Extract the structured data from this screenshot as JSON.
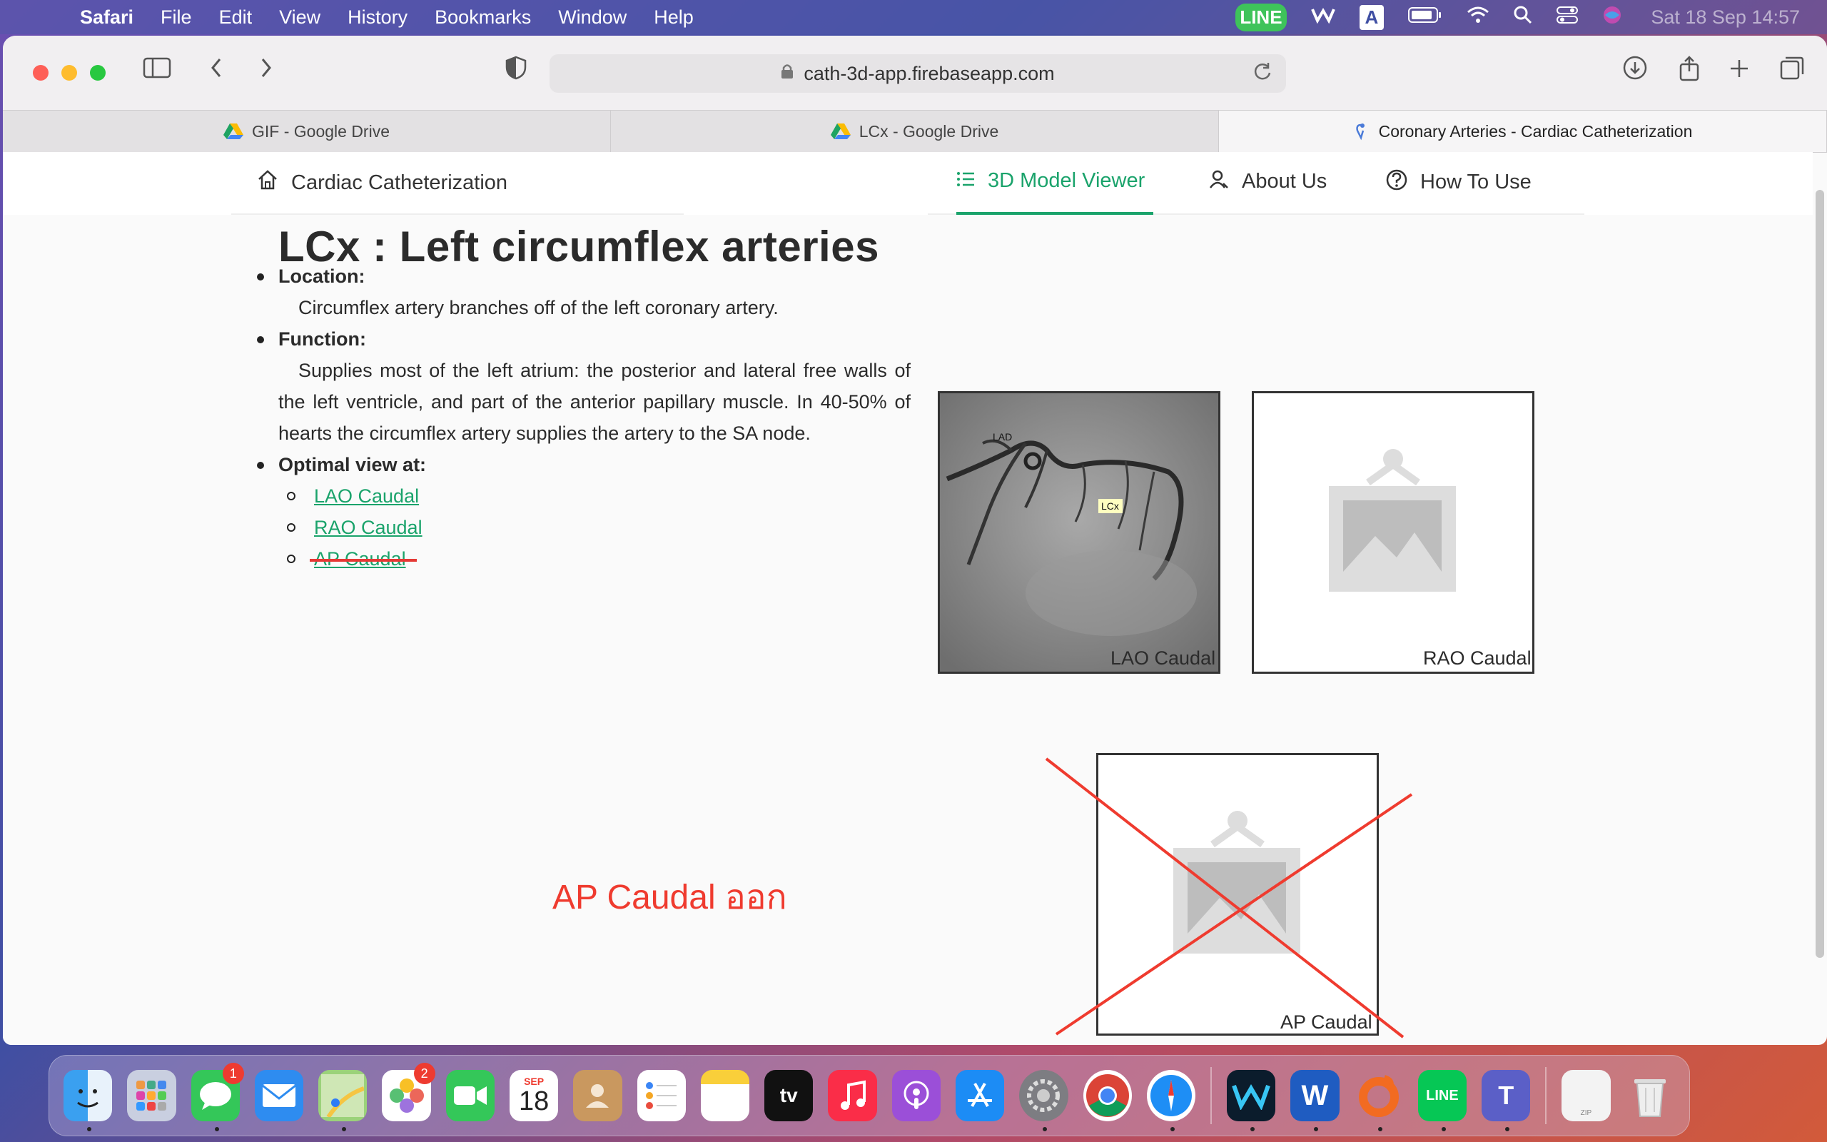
{
  "menubar": {
    "app": "Safari",
    "items": [
      "File",
      "Edit",
      "View",
      "History",
      "Bookmarks",
      "Window",
      "Help"
    ],
    "line_icon_text": "LINE",
    "input_source": "A",
    "clock": "Sat 18 Sep  14:57"
  },
  "browser": {
    "url": "cath-3d-app.firebaseapp.com",
    "tabs": [
      {
        "label": "GIF - Google Drive"
      },
      {
        "label": "LCx - Google Drive"
      },
      {
        "label": "Coronary Arteries - Cardiac Catheterization"
      }
    ]
  },
  "nav": {
    "brand": "Cardiac Catheterization",
    "items": [
      {
        "label": "3D Model Viewer"
      },
      {
        "label": "About Us"
      },
      {
        "label": "How To Use"
      }
    ]
  },
  "page": {
    "title": "LCx : Left circumflex arteries",
    "location_label": "Location:",
    "location_text": "Circumflex artery branches off of the left coronary artery.",
    "function_label": "Function:",
    "function_text": "Supplies most of the left atrium: the posterior and lateral free walls of the left ventricle, and part of the anterior papillary muscle. In 40-50% of hearts the circumflex artery supplies the artery to the SA node.",
    "optimal_label": "Optimal view at:",
    "views": [
      "LAO Caudal",
      "RAO Caudal",
      "AP Caudal"
    ],
    "image_captions": [
      "LAO Caudal",
      "RAO Caudal",
      "AP Caudal"
    ],
    "angio_labels": [
      "LAD",
      "LCx"
    ],
    "annotation": "AP Caudal ออก"
  },
  "dock": {
    "messages_badge": "1",
    "photos_badge": "2",
    "calendar_month": "SEP",
    "calendar_day": "18",
    "tv_label": "tv",
    "line_label": "LINE",
    "zip_label": "ZIP"
  },
  "colors": {
    "accent": "#1aa36b",
    "annotation": "#ef3b2f"
  }
}
